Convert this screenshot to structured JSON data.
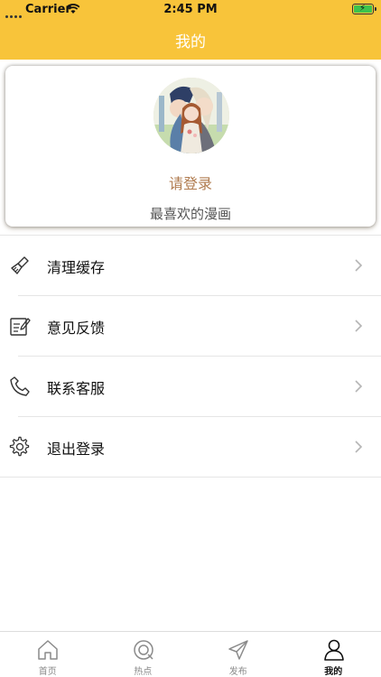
{
  "status_bar": {
    "carrier": "Carrier",
    "time": "2:45 PM"
  },
  "nav": {
    "title": "我的"
  },
  "profile": {
    "login_prompt": "请登录",
    "favorites_label": "最喜欢的漫画"
  },
  "menu": [
    {
      "label": "清理缓存",
      "icon": "broom-icon"
    },
    {
      "label": "意见反馈",
      "icon": "edit-note-icon"
    },
    {
      "label": "联系客服",
      "icon": "phone-icon"
    },
    {
      "label": "退出登录",
      "icon": "gear-icon"
    }
  ],
  "tabs": [
    {
      "label": "首页",
      "icon": "home-icon"
    },
    {
      "label": "热点",
      "icon": "hotspot-icon"
    },
    {
      "label": "发布",
      "icon": "send-icon"
    },
    {
      "label": "我的",
      "icon": "person-icon",
      "active": true
    }
  ],
  "colors": {
    "header": "#f8c43a",
    "login_text": "#b07b4f",
    "battery": "#3ec34d"
  }
}
